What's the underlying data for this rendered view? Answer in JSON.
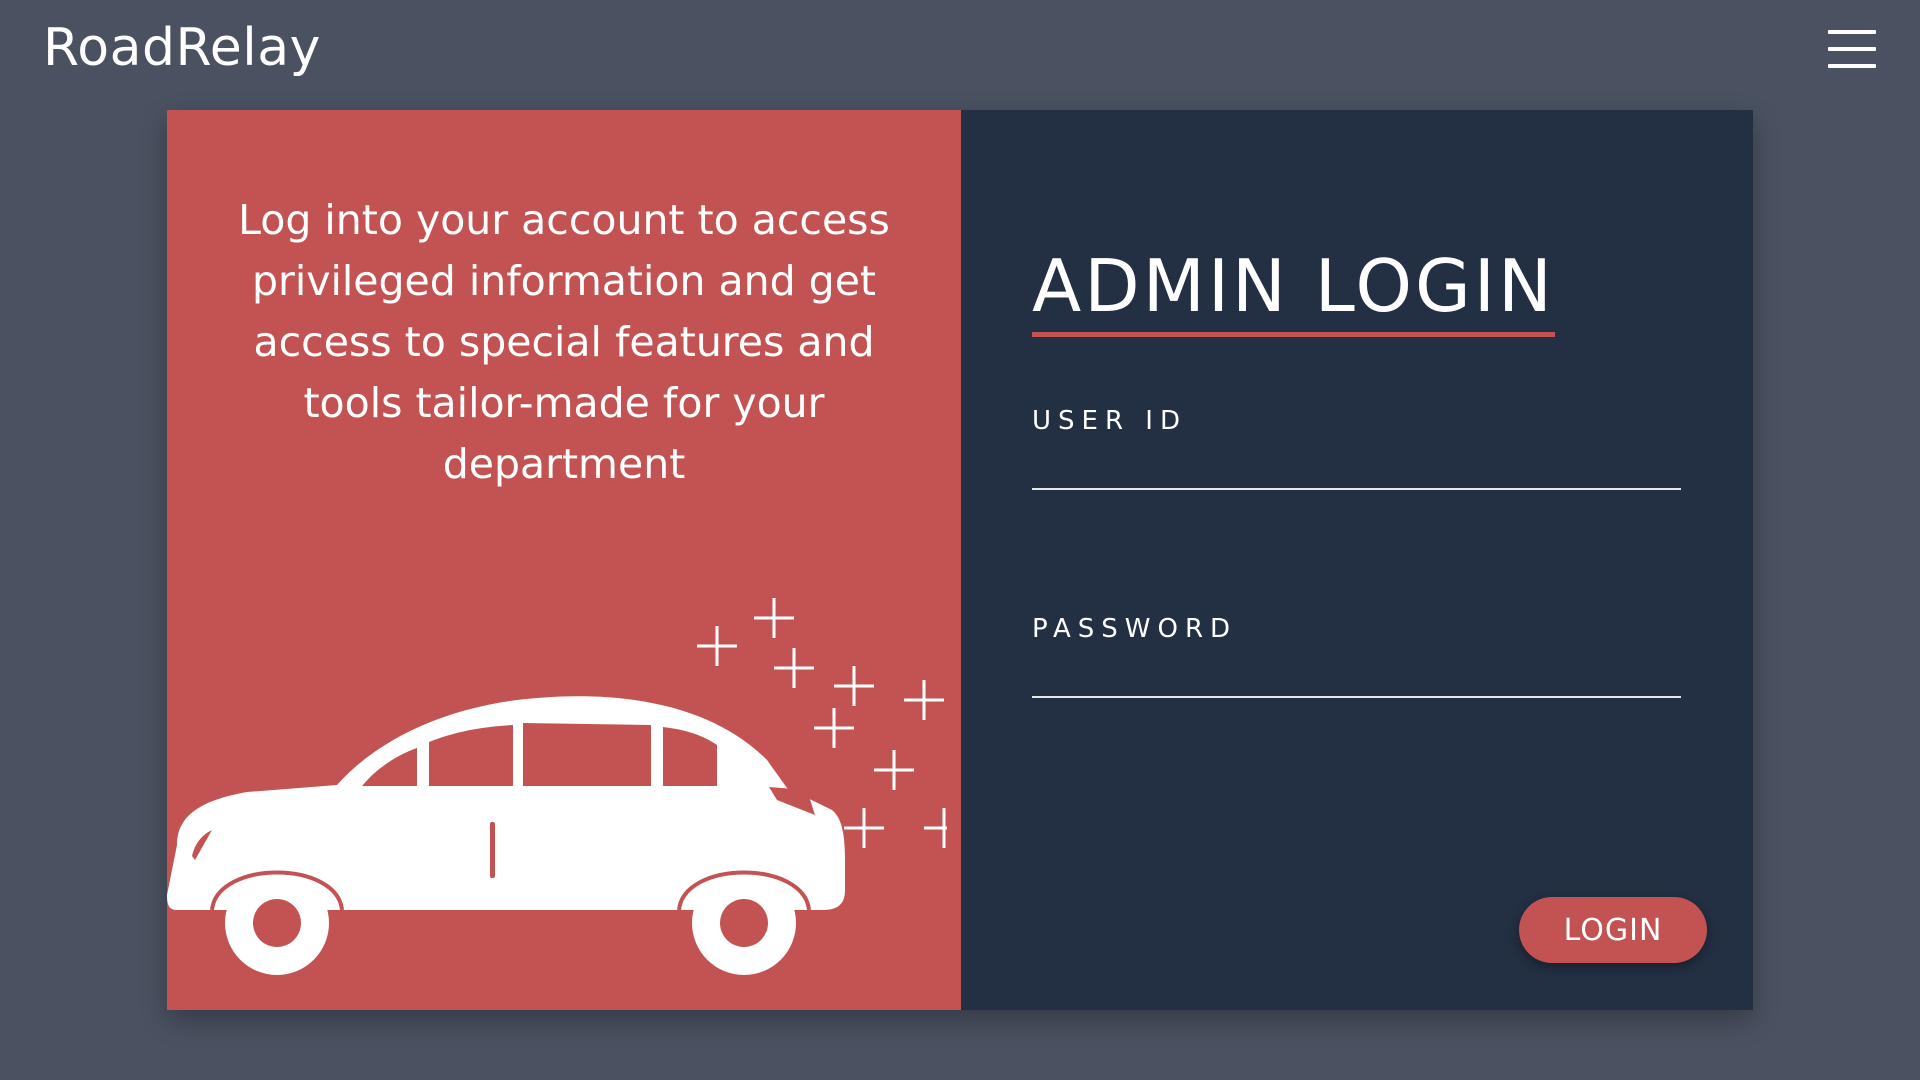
{
  "header": {
    "brand": "RoadRelay",
    "menu_icon": "hamburger-menu-icon"
  },
  "intro": {
    "text": "Log into your account to access privileged information and get access to special features and tools tailor-made for your department"
  },
  "illustration": {
    "icon": "car-with-sparkles-icon"
  },
  "login": {
    "title": "ADMIN LOGIN",
    "user_id_label": "USER  ID",
    "user_id_value": "",
    "password_label": "PASSWORD",
    "password_value": "",
    "button_label": "LOGIN"
  },
  "colors": {
    "background": "#4a5160",
    "accent": "#c35353",
    "panel_dark": "#232f42",
    "text": "#ffffff"
  }
}
